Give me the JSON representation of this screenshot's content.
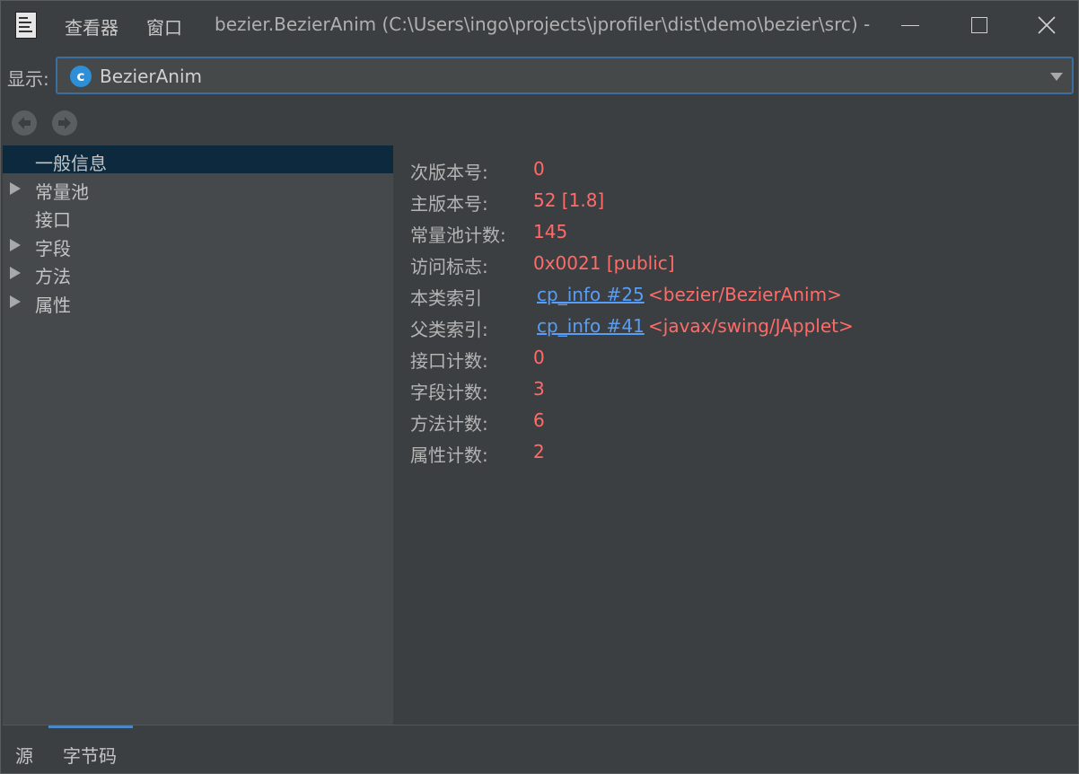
{
  "window": {
    "menu": [
      "查看器",
      "窗口"
    ],
    "title": "bezier.BezierAnim (C:\\Users\\ingo\\projects\\jprofiler\\dist\\demo\\bezier\\src) - JP..."
  },
  "show": {
    "label": "显示:",
    "icon_letter": "c",
    "selected": "BezierAnim"
  },
  "tree": {
    "items": [
      {
        "label": "一般信息",
        "expandable": false,
        "selected": true
      },
      {
        "label": "常量池",
        "expandable": true
      },
      {
        "label": "接口",
        "expandable": false
      },
      {
        "label": "字段",
        "expandable": true
      },
      {
        "label": "方法",
        "expandable": true
      },
      {
        "label": "属性",
        "expandable": true
      }
    ]
  },
  "details": {
    "minor_version": {
      "label": "次版本号:",
      "value": "0"
    },
    "major_version": {
      "label": "主版本号:",
      "value": "52 [1.8]"
    },
    "cp_count": {
      "label": "常量池计数:",
      "value": "145"
    },
    "access_flags": {
      "label": "访问标志:",
      "value": "0x0021 [public]"
    },
    "this_class": {
      "label": "本类索引",
      "link": "cp_info #25",
      "ref": "<bezier/BezierAnim>"
    },
    "super_class": {
      "label": "父类索引:",
      "link": "cp_info #41",
      "ref": "<javax/swing/JApplet>"
    },
    "interfaces_count": {
      "label": "接口计数:",
      "value": "0"
    },
    "fields_count": {
      "label": "字段计数:",
      "value": "3"
    },
    "methods_count": {
      "label": "方法计数:",
      "value": "6"
    },
    "attributes_count": {
      "label": "属性计数:",
      "value": "2"
    }
  },
  "bottom_tabs": {
    "source": "源",
    "bytecode": "字节码",
    "active": "bytecode"
  }
}
